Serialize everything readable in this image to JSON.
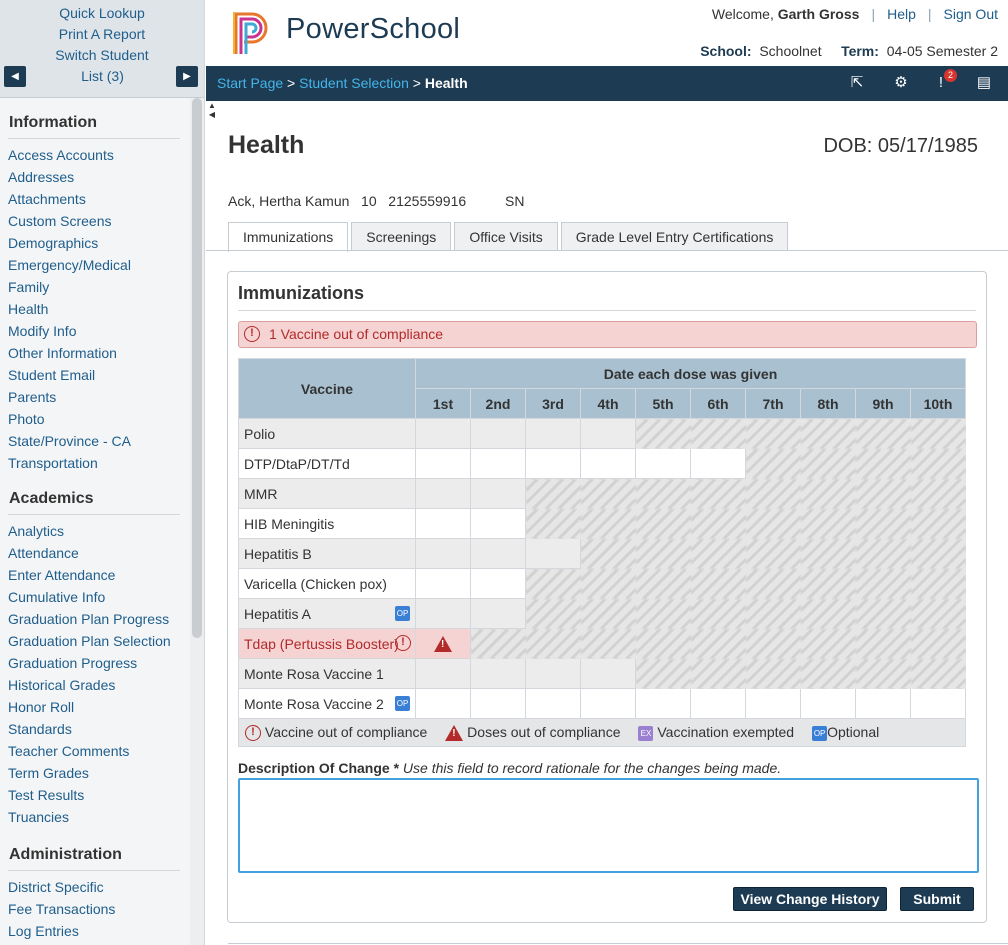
{
  "sidebar": {
    "quick_links": [
      "Quick Lookup",
      "Print A Report",
      "Switch Student"
    ],
    "list_label": "List (3)",
    "sections": [
      {
        "title": "Information",
        "items": [
          "Access Accounts",
          "Addresses",
          "Attachments",
          "Custom Screens",
          "Demographics",
          "Emergency/Medical",
          "Family",
          "Health",
          "Modify Info",
          "Other Information",
          "Student Email",
          "Parents",
          "Photo",
          "State/Province - CA",
          "Transportation"
        ]
      },
      {
        "title": "Academics",
        "items": [
          "Analytics",
          "Attendance",
          "Enter Attendance",
          "Cumulative Info",
          "Graduation Plan Progress",
          "Graduation Plan Selection",
          "Graduation Progress",
          "Historical Grades",
          "Honor Roll",
          "Standards",
          "Teacher Comments",
          "Term Grades",
          "Test Results",
          "Truancies"
        ]
      },
      {
        "title": "Administration",
        "items": [
          "District Specific",
          "Fee Transactions",
          "Log Entries"
        ]
      }
    ]
  },
  "header": {
    "logo_text": "PowerSchool",
    "welcome_prefix": "Welcome, ",
    "user_name": "Garth Gross",
    "help": "Help",
    "sign_out": "Sign Out",
    "school_label": "School:",
    "school_value": "Schoolnet",
    "term_label": "Term:",
    "term_value": "04-05 Semester 2",
    "alert_count": "2"
  },
  "breadcrumb": {
    "start": "Start Page",
    "sep1": " > ",
    "selection": "Student Selection",
    "sep2": " > ",
    "current": "Health"
  },
  "page": {
    "title": "Health",
    "dob": "DOB: 05/17/1985",
    "student_info": "Ack, Hertha Kamun   10   2125559916          SN"
  },
  "tabs": [
    "Immunizations",
    "Screenings",
    "Office Visits",
    "Grade Level Entry Certifications"
  ],
  "immunizations": {
    "title": "Immunizations",
    "alert": "1 Vaccine out of compliance",
    "col_vaccine": "Vaccine",
    "col_dates": "Date each dose was given",
    "doses": [
      "1st",
      "2nd",
      "3rd",
      "4th",
      "5th",
      "6th",
      "7th",
      "8th",
      "9th",
      "10th"
    ],
    "vaccines": [
      {
        "name": "Polio",
        "doses": 4,
        "op": false,
        "bad": false
      },
      {
        "name": "DTP/DtaP/DT/Td",
        "doses": 6,
        "op": false,
        "bad": false
      },
      {
        "name": "MMR",
        "doses": 2,
        "op": false,
        "bad": false
      },
      {
        "name": "HIB Meningitis",
        "doses": 2,
        "op": false,
        "bad": false
      },
      {
        "name": "Hepatitis B",
        "doses": 3,
        "op": false,
        "bad": false
      },
      {
        "name": "Varicella (Chicken pox)",
        "doses": 2,
        "op": false,
        "bad": false
      },
      {
        "name": "Hepatitis A",
        "doses": 2,
        "op": true,
        "bad": false
      },
      {
        "name": "Tdap (Pertussis Booster)",
        "doses": 1,
        "op": false,
        "bad": true
      },
      {
        "name": "Monte Rosa Vaccine 1",
        "doses": 4,
        "op": false,
        "bad": false
      },
      {
        "name": "Monte Rosa Vaccine 2",
        "doses": 10,
        "op": true,
        "bad": false
      }
    ],
    "legend": {
      "vaccine_out": "Vaccine out of compliance",
      "doses_out": "Doses out of compliance",
      "exempted": "Vaccination exempted",
      "optional": "Optional",
      "op_glyph": "OP",
      "ex_glyph": "EX"
    },
    "desc_label": "Description Of Change *",
    "desc_hint": " Use this field to record rationale for the changes being made.",
    "history_button": "View Change History",
    "submit_button": "Submit"
  }
}
